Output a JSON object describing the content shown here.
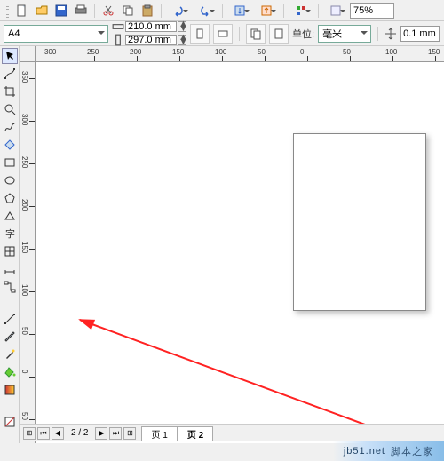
{
  "toolbar": {
    "zoom_value": "75%"
  },
  "property_bar": {
    "page_preset": "A4",
    "width": "210.0 mm",
    "height": "297.0 mm",
    "units_label": "单位:",
    "units_value": "毫米",
    "nudge": "0.1 mm"
  },
  "ruler_h_ticks": [
    "300",
    "250",
    "200",
    "150",
    "100",
    "50",
    "0",
    "50",
    "100",
    "150"
  ],
  "ruler_v_ticks": [
    "350",
    "300",
    "250",
    "200",
    "150",
    "100",
    "50",
    "0",
    "50"
  ],
  "status": {
    "page_info": "2 / 2",
    "tabs": [
      "页 1",
      "页 2"
    ],
    "active_tab": 1
  },
  "watermark": {
    "domain": "jb51.net",
    "name": "脚本之家"
  },
  "icons": {
    "new": "new-file-icon",
    "open": "open-icon",
    "save": "save-icon",
    "print": "print-icon",
    "cut": "cut-icon",
    "copy": "copy-icon",
    "paste": "paste-icon",
    "undo": "undo-icon",
    "redo": "redo-icon",
    "import": "import-icon",
    "export": "export-icon",
    "launch": "app-launcher-icon",
    "opts": "options-icon"
  },
  "tools": [
    "pick",
    "shape-edit",
    "crop",
    "zoom",
    "freehand",
    "bezier",
    "smart-draw",
    "rectangle",
    "ellipse",
    "polygon",
    "spiral",
    "text",
    "table",
    "dimension",
    "connector",
    "effects",
    "eyedropper",
    "outline",
    "fill",
    "blend",
    "transparency"
  ]
}
